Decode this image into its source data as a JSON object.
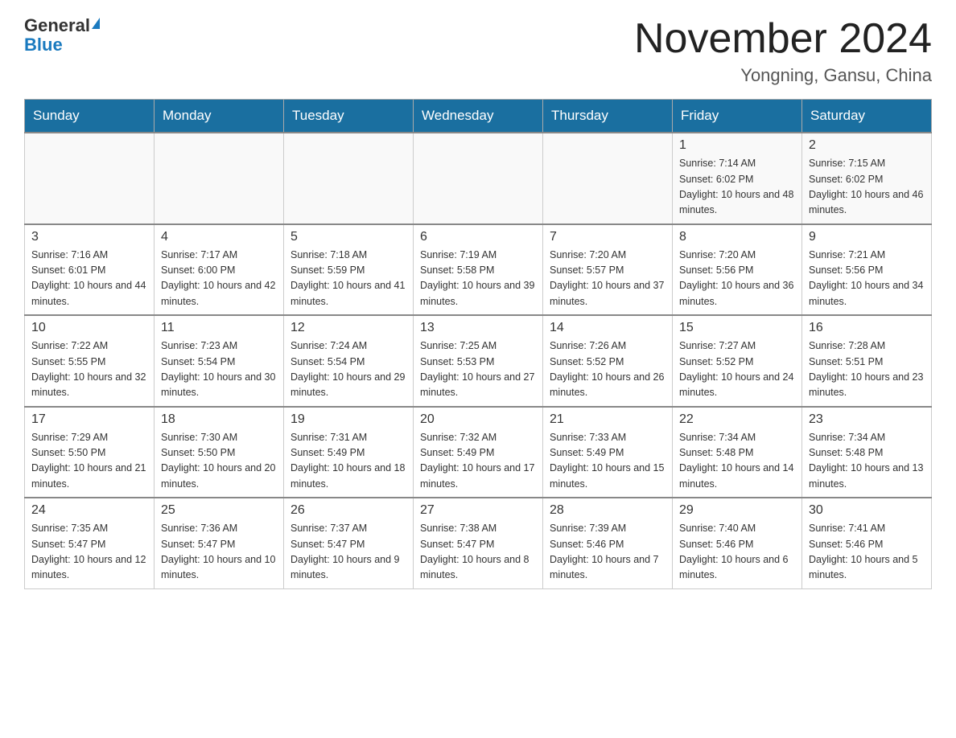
{
  "header": {
    "logo_general": "General",
    "logo_blue": "Blue",
    "month_title": "November 2024",
    "location": "Yongning, Gansu, China"
  },
  "days_of_week": [
    "Sunday",
    "Monday",
    "Tuesday",
    "Wednesday",
    "Thursday",
    "Friday",
    "Saturday"
  ],
  "weeks": [
    [
      {
        "day": "",
        "info": ""
      },
      {
        "day": "",
        "info": ""
      },
      {
        "day": "",
        "info": ""
      },
      {
        "day": "",
        "info": ""
      },
      {
        "day": "",
        "info": ""
      },
      {
        "day": "1",
        "info": "Sunrise: 7:14 AM\nSunset: 6:02 PM\nDaylight: 10 hours and 48 minutes."
      },
      {
        "day": "2",
        "info": "Sunrise: 7:15 AM\nSunset: 6:02 PM\nDaylight: 10 hours and 46 minutes."
      }
    ],
    [
      {
        "day": "3",
        "info": "Sunrise: 7:16 AM\nSunset: 6:01 PM\nDaylight: 10 hours and 44 minutes."
      },
      {
        "day": "4",
        "info": "Sunrise: 7:17 AM\nSunset: 6:00 PM\nDaylight: 10 hours and 42 minutes."
      },
      {
        "day": "5",
        "info": "Sunrise: 7:18 AM\nSunset: 5:59 PM\nDaylight: 10 hours and 41 minutes."
      },
      {
        "day": "6",
        "info": "Sunrise: 7:19 AM\nSunset: 5:58 PM\nDaylight: 10 hours and 39 minutes."
      },
      {
        "day": "7",
        "info": "Sunrise: 7:20 AM\nSunset: 5:57 PM\nDaylight: 10 hours and 37 minutes."
      },
      {
        "day": "8",
        "info": "Sunrise: 7:20 AM\nSunset: 5:56 PM\nDaylight: 10 hours and 36 minutes."
      },
      {
        "day": "9",
        "info": "Sunrise: 7:21 AM\nSunset: 5:56 PM\nDaylight: 10 hours and 34 minutes."
      }
    ],
    [
      {
        "day": "10",
        "info": "Sunrise: 7:22 AM\nSunset: 5:55 PM\nDaylight: 10 hours and 32 minutes."
      },
      {
        "day": "11",
        "info": "Sunrise: 7:23 AM\nSunset: 5:54 PM\nDaylight: 10 hours and 30 minutes."
      },
      {
        "day": "12",
        "info": "Sunrise: 7:24 AM\nSunset: 5:54 PM\nDaylight: 10 hours and 29 minutes."
      },
      {
        "day": "13",
        "info": "Sunrise: 7:25 AM\nSunset: 5:53 PM\nDaylight: 10 hours and 27 minutes."
      },
      {
        "day": "14",
        "info": "Sunrise: 7:26 AM\nSunset: 5:52 PM\nDaylight: 10 hours and 26 minutes."
      },
      {
        "day": "15",
        "info": "Sunrise: 7:27 AM\nSunset: 5:52 PM\nDaylight: 10 hours and 24 minutes."
      },
      {
        "day": "16",
        "info": "Sunrise: 7:28 AM\nSunset: 5:51 PM\nDaylight: 10 hours and 23 minutes."
      }
    ],
    [
      {
        "day": "17",
        "info": "Sunrise: 7:29 AM\nSunset: 5:50 PM\nDaylight: 10 hours and 21 minutes."
      },
      {
        "day": "18",
        "info": "Sunrise: 7:30 AM\nSunset: 5:50 PM\nDaylight: 10 hours and 20 minutes."
      },
      {
        "day": "19",
        "info": "Sunrise: 7:31 AM\nSunset: 5:49 PM\nDaylight: 10 hours and 18 minutes."
      },
      {
        "day": "20",
        "info": "Sunrise: 7:32 AM\nSunset: 5:49 PM\nDaylight: 10 hours and 17 minutes."
      },
      {
        "day": "21",
        "info": "Sunrise: 7:33 AM\nSunset: 5:49 PM\nDaylight: 10 hours and 15 minutes."
      },
      {
        "day": "22",
        "info": "Sunrise: 7:34 AM\nSunset: 5:48 PM\nDaylight: 10 hours and 14 minutes."
      },
      {
        "day": "23",
        "info": "Sunrise: 7:34 AM\nSunset: 5:48 PM\nDaylight: 10 hours and 13 minutes."
      }
    ],
    [
      {
        "day": "24",
        "info": "Sunrise: 7:35 AM\nSunset: 5:47 PM\nDaylight: 10 hours and 12 minutes."
      },
      {
        "day": "25",
        "info": "Sunrise: 7:36 AM\nSunset: 5:47 PM\nDaylight: 10 hours and 10 minutes."
      },
      {
        "day": "26",
        "info": "Sunrise: 7:37 AM\nSunset: 5:47 PM\nDaylight: 10 hours and 9 minutes."
      },
      {
        "day": "27",
        "info": "Sunrise: 7:38 AM\nSunset: 5:47 PM\nDaylight: 10 hours and 8 minutes."
      },
      {
        "day": "28",
        "info": "Sunrise: 7:39 AM\nSunset: 5:46 PM\nDaylight: 10 hours and 7 minutes."
      },
      {
        "day": "29",
        "info": "Sunrise: 7:40 AM\nSunset: 5:46 PM\nDaylight: 10 hours and 6 minutes."
      },
      {
        "day": "30",
        "info": "Sunrise: 7:41 AM\nSunset: 5:46 PM\nDaylight: 10 hours and 5 minutes."
      }
    ]
  ]
}
